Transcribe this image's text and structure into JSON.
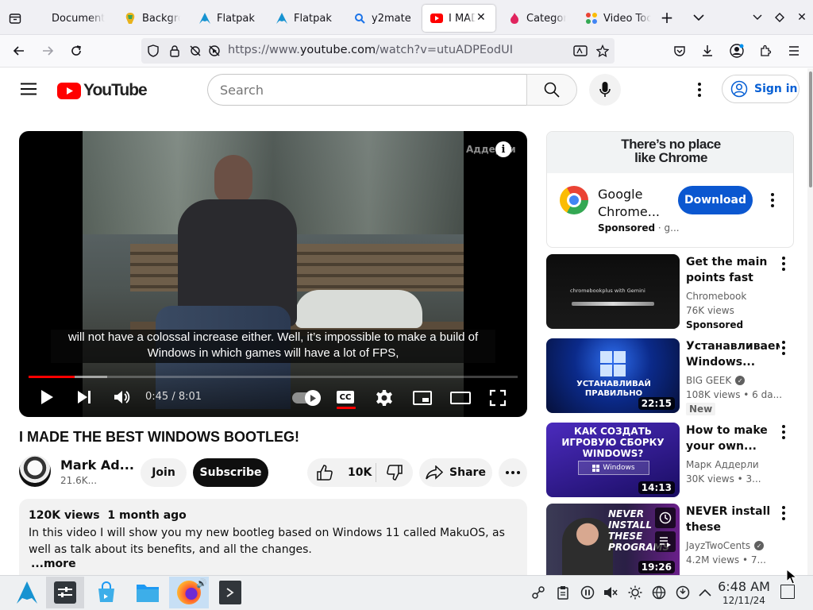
{
  "browser": {
    "tabs": [
      {
        "label": "Documentation",
        "icon": "doc-icon"
      },
      {
        "label": "Background",
        "icon": "brush-icon"
      },
      {
        "label": "Flatpak",
        "icon": "arch-icon"
      },
      {
        "label": "Flatpak",
        "icon": "arch-icon"
      },
      {
        "label": "y2mate",
        "icon": "search-icon"
      },
      {
        "label": "I MADE",
        "icon": "youtube-icon",
        "active": true
      },
      {
        "label": "Category",
        "icon": "flame-icon"
      },
      {
        "label": "Video Tools",
        "icon": "dots-icon"
      }
    ],
    "url": {
      "prefix": "https://www.",
      "domain": "youtube.com",
      "path": "/watch?v=utuADPEodUI"
    }
  },
  "youtube": {
    "logo_text": "YouTube",
    "search_placeholder": "Search",
    "sign_in": "Sign in",
    "player": {
      "watermark": "Аддерли",
      "subtitle_line1": "will not have a colossal increase either. Well, it’s impossible to make a build of",
      "subtitle_line2": "Windows in which games will have a lot of FPS,",
      "time": "0:45 / 8:01",
      "progress": 0.094,
      "buffered": 0.16,
      "cc": "CC"
    },
    "video_title": "I MADE THE BEST WINDOWS BOOTLEG!",
    "channel": {
      "name": "Mark Ad...",
      "subs": "21.6K..."
    },
    "buttons": {
      "join": "Join",
      "subscribe": "Subscribe",
      "likes": "10K",
      "share": "Share"
    },
    "description": {
      "views": "120K views",
      "date": "1 month ago",
      "text": "In this video I will show you my new bootleg based on Windows 11 called MakuOS, as well as talk about its benefits, and all the changes.",
      "more": "...more"
    },
    "ad": {
      "banner_line1": "There’s no place",
      "banner_line2": "like Chrome",
      "title": "Google Chrome...",
      "sponsored": "Sponsored",
      "domain": "g...",
      "button": "Download"
    },
    "related": [
      {
        "title": "Get the main points fast from...",
        "channel": "Chromebook",
        "meta": "76K views",
        "badge": "Sponsored",
        "duration": "",
        "thumb_text": "chromebookplus with Gemini"
      },
      {
        "title": "Устанавливаем Windows...",
        "channel": "BIG GEEK",
        "meta": "108K views  •  6 da...",
        "badge": "New",
        "duration": "22:15",
        "thumb_text": "УСТАНАВЛИВАЙ ПРАВИЛЬНО"
      },
      {
        "title": "How to make your own...",
        "channel": "Марк Аддерли",
        "meta": "30K views  •  3...",
        "badge": "",
        "duration": "14:13",
        "thumb_text": "КАК СОЗДАТЬ ИГРОВУЮ СБОРКУ WINDOWS?"
      },
      {
        "title": "NEVER install these programs...",
        "channel": "JayzTwoCents",
        "meta": "4.2M views  •  7...",
        "badge": "",
        "duration": "19:26",
        "thumb_text": "NEVER INSTALL THESE PROGRAMS"
      }
    ],
    "thumb_extra": {
      "windows_label": "Windows"
    }
  },
  "taskbar": {
    "time": "6:48 AM",
    "date": "12/11/24"
  },
  "colors": {
    "yt_red": "#ff0000",
    "link_blue": "#065fd4",
    "download_blue": "#0b57d0"
  }
}
